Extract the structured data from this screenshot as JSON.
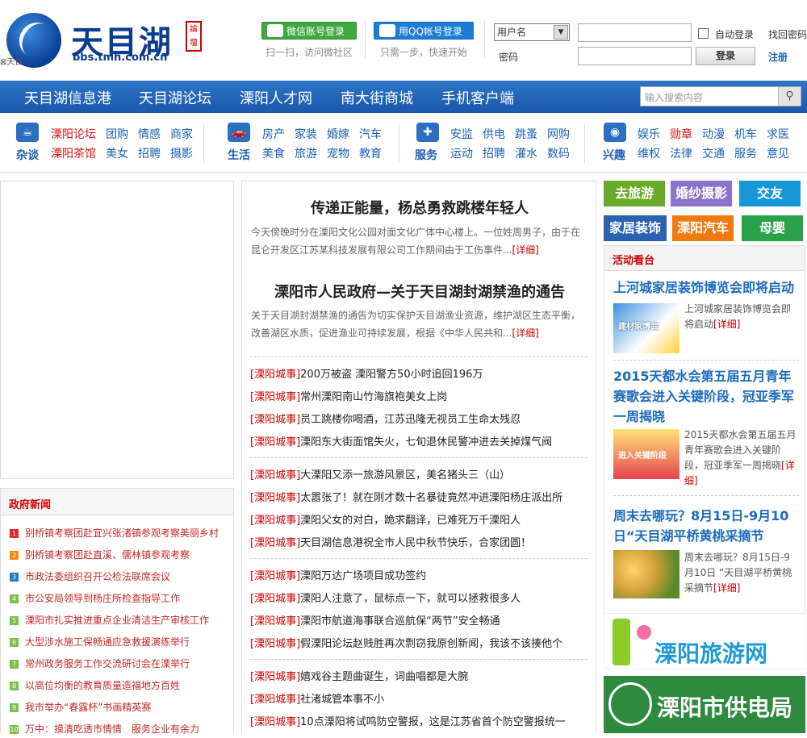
{
  "header": {
    "logo_text": "天目湖",
    "logo_seal": "論壇",
    "logo_url": "bbs.tmh.com.cn",
    "broken_image_alt": "天目",
    "wechat_login": "微信账号登录",
    "wechat_sub": "扫一扫，访问微社区",
    "qq_login": "用QQ帐号登录",
    "qq_sub": "只需一步，快速开始",
    "username_select": "用户名",
    "password_label": "密码",
    "auto_login": "自动登录",
    "find_password": "找回密码",
    "login_button": "登录",
    "register": "注册"
  },
  "nav": {
    "items": [
      "天目湖信息港",
      "天目湖论坛",
      "溧阳人才网",
      "南大街商城",
      "手机客户端"
    ],
    "search_placeholder": "输入搜索内容"
  },
  "categories": [
    {
      "name": "杂谈",
      "links_row1": [
        "溧阳论坛",
        "团购",
        "情感",
        "商家"
      ],
      "links_row2": [
        "溧阳茶馆",
        "美女",
        "招聘",
        "摄影"
      ]
    },
    {
      "name": "生活",
      "links_row1": [
        "房产",
        "家装",
        "婚嫁",
        "汽车"
      ],
      "links_row2": [
        "美食",
        "旅游",
        "宠物",
        "教育"
      ]
    },
    {
      "name": "服务",
      "links_row1": [
        "安监",
        "供电",
        "跳蚤",
        "网购"
      ],
      "links_row2": [
        "运动",
        "招聘",
        "灌水",
        "数码"
      ]
    },
    {
      "name": "兴趣",
      "links_row1": [
        "娱乐",
        "勋章",
        "动漫",
        "机车",
        "求医"
      ],
      "links_row2": [
        "维权",
        "法律",
        "交通",
        "服务",
        "意见"
      ]
    }
  ],
  "gov_news": {
    "title": "政府新闻",
    "items": [
      "别桥镇考察团赴宜兴张渚镇参观考察美丽乡村",
      "别桥镇考察团赴直溪、儒林镇参观考察",
      "市政法委组织召开公检法联席会议",
      "市公安局领导到杨庄所检查指导工作",
      "溧阳市扎实推进重点企业清洁生产审核工作",
      "大型涉水施工保畅通应急救援演练举行",
      "常州政务服务工作交流研讨会在溧举行",
      "以高位均衡的教育质量造福地方百姓",
      "我市举办“春露杯”书画精英赛",
      "万中：摸清吃透市情情　服务企业有余力"
    ]
  },
  "center": {
    "headline1": "传递正能量，杨总勇救跳楼年轻人",
    "summary1": "今天傍晚时分在溧阳文化公园对面文化广体中心楼上。一位姓周男子，由于在昆仑开发区江苏某科技发展有限公司工作期间由于工伤事件...",
    "headline2": "溧阳市人民政府—关于天目湖封湖禁渔的通告",
    "summary2": "关于天目湖封湖禁渔的通告为切实保护天目湖渔业资源，维护湖区生态平衡，改善湖区水质，促进渔业可持续发展，根据《中华人民共和...",
    "more": "[详细]",
    "tag": "[溧阳城事]",
    "news_groups": [
      [
        "200万被盗 溧阳警方50小时追回196万",
        "常州溧阳南山竹海旗袍美女上岗",
        "员工跳楼你喝酒，江苏迅隆无视员工生命太残忍",
        "溧阳东大街面馆失火，七旬退休民警冲进去关掉煤气阀"
      ],
      [
        "大溧阳又添一旅游风景区，美名猪头三（山）",
        "太嚣张了！就在刚才数十名暴徒竟然冲进溧阳杨庄派出所",
        "溧阳父女的对白，跪求翻译，已难死万千溧阳人",
        "天目湖信息港祝全市人民中秋节快乐，合家团圆！"
      ],
      [
        "溧阳万达广场项目成功签约",
        "溧阳人注意了，鼠标点一下，就可以拯救很多人",
        "溧阳市航道海事联合巡航保“两节”安全畅通",
        "假溧阳论坛赵贱胜再次剽窃我原创新闻，我该不该揍他个"
      ],
      [
        "嬉戏谷主题曲诞生，词曲唱都是大腕",
        "社渚城管本事不小",
        "10点溧阳将试鸣防空警报，这是江苏省首个防空警报统一"
      ]
    ]
  },
  "right": {
    "tiles": [
      {
        "label": "去旅游",
        "color": "#6aaa2a"
      },
      {
        "label": "婚纱摄影",
        "color": "#8a73c8"
      },
      {
        "label": "交友",
        "color": "#1597d8"
      },
      {
        "label": "家居装饰",
        "color": "#2b62b0"
      },
      {
        "label": "溧阳汽车",
        "color": "#f07a12"
      },
      {
        "label": "母婴",
        "color": "#2aa24b"
      }
    ],
    "activity_title": "活动看台",
    "activities": [
      {
        "title": "上河城家居装饰博览会即将启动",
        "summary": "上河城家居装饰博览会即将启动",
        "more": "[详细]",
        "img_text": "建材家博会"
      },
      {
        "title": "2015天都水会第五届五月青年赛歌会进入关键阶段，冠亚季军一周揭晓",
        "summary": "2015天都水会第五届五月青年赛歌会进入关键阶段，冠亚季军一周揭晓",
        "more": "[详细]",
        "img_text": "进入关键阶段"
      },
      {
        "title": "周末去哪玩？8月15日-9月10日“天目湖平桥黄桃采摘节",
        "summary": "周末去哪玩？8月15日-9月10日 “天目湖平桥黄桃采摘节",
        "more": "[详细]",
        "img_text": ""
      }
    ],
    "banner1": "溧阳旅游网",
    "banner2": "溧阳市供电局"
  }
}
